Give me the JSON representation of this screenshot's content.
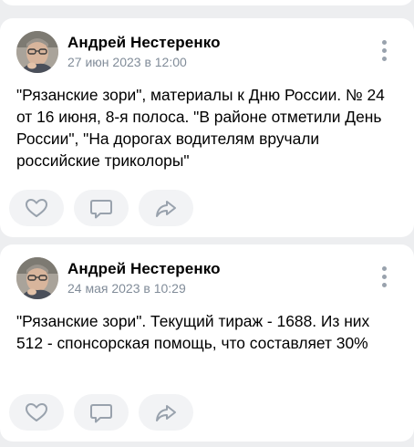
{
  "posts": [
    {
      "author": "Андрей Нестеренко",
      "date": "27 июн 2023 в 12:00",
      "text": "\"Рязанские зори\", материалы к Дню России. № 24 от 16 июня, 8-я полоса. \"В районе отметили День России\", \"На дорогах водителям вручали российские триколоры\"",
      "actions": [
        "like-icon",
        "comment-icon",
        "share-icon"
      ]
    },
    {
      "author": "Андрей Нестеренко",
      "date": "24 мая 2023 в 10:29",
      "text": "\"Рязанские зори\". Текущий тираж - 1688. Из них 512 - спонсорская помощь, что составляет 30%",
      "actions": [
        "like-icon",
        "comment-icon",
        "share-icon"
      ]
    }
  ],
  "colors": {
    "background": "#edeef0",
    "card": "#ffffff",
    "icon": "#99a2ad",
    "secondary_text": "#818c99",
    "button_bg": "#f2f3f5"
  }
}
